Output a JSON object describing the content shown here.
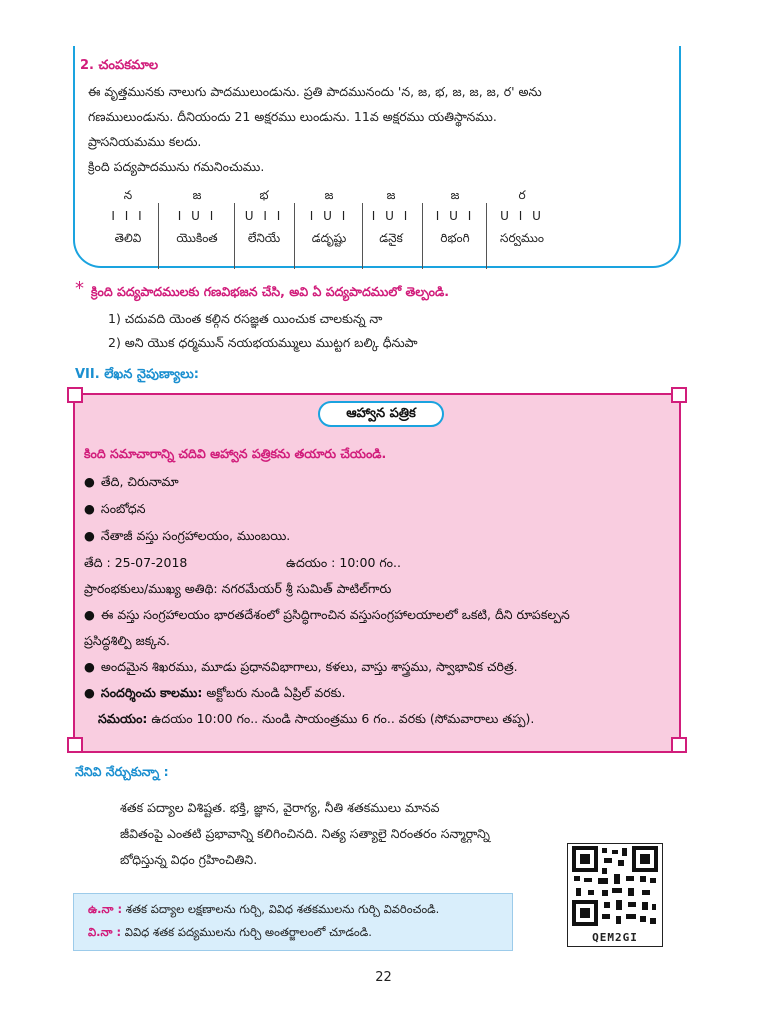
{
  "box1": {
    "title": "2. చంపకమాల",
    "lines": [
      "ఈ వృత్తమునకు నాలుగు పాదములుండును. ప్రతి పాదమునందు 'న, జ, భ, జ, జ, జ, ర' అను",
      "గణములుండును. దీనియందు 21 అక్షరము లుండును. 11వ అక్షరము యతిస్థానము.",
      "ప్రాసనియమము కలదు.",
      "క్రింది పద్యపాదమును గమనించుము."
    ],
    "ganas": [
      {
        "name": "న",
        "pattern": "I I I",
        "word": "తెలివి"
      },
      {
        "name": "జ",
        "pattern": "I U I",
        "word": "యొకింత"
      },
      {
        "name": "భ",
        "pattern": "U I I",
        "word": "లేనియే"
      },
      {
        "name": "జ",
        "pattern": "I U I",
        "word": "డదృష్టు"
      },
      {
        "name": "జ",
        "pattern": "I U I",
        "word": "డనైక"
      },
      {
        "name": "జ",
        "pattern": "I U I",
        "word": "రిభంగి"
      },
      {
        "name": "ర",
        "pattern": "U I U",
        "word": "సర్వముం"
      }
    ]
  },
  "exercise": {
    "star": "*",
    "instruction": "క్రింది పద్యపాదములకు గణవిభజన చేసి, అవి ఏ పద్యపాదములో తెల్పండి.",
    "items": [
      "1)  చదువది యెంత కల్గిన రసజ్ఞత యించుక చాలకున్న నా",
      "2)  అని యొక ధర్మమున్ నయభయమ్ములు ముట్టగ బల్కి ధీనుపా"
    ]
  },
  "section_vii": {
    "title": "VII. లేఖన నైపుణ్యాలు:"
  },
  "invitation": {
    "title": "ఆహ్వాన పత్రిక",
    "instruction": "కింది సమాచారాన్ని చదివి ఆహ్వాన పత్రికను తయారు చేయండి.",
    "bullets": [
      "తేది, చిరునామా",
      "సంబోధన",
      "నేతాజీ వస్తు సంగ్రహాలయం, ముంబయి."
    ],
    "date_line": "తేది : 25-07-2018",
    "time_line": "ఉదయం : 10:00 గం..",
    "chief_guest": "ప్రారంభకులు/ముఖ్య అతిథి: నగరమేయర్ శ్రీ సుమిత్ పాటిల్‌గారు",
    "feature1_a": "ఈ వస్తు సంగ్రహాలయం భారతదేశంలో ప్రసిద్ధిగాంచిన వస్తుసంగ్రహాలయాలలో ఒకటి, దీని రూపకల్పన",
    "feature1_b": "ప్రసిద్ధశిల్పి జక్కన.",
    "feature2": "అందమైన శిఖరము, మూడు ప్రధానవిభాగాలు, కళలు, వాస్తు శాస్త్రము, స్వాభావిక చరిత్ర.",
    "visit_label": "సందర్శించు కాలము:",
    "visit_value": " అక్టోబరు నుండి ఏప్రిల్ వరకు.",
    "timing_label": "సమయం:",
    "timing_value": " ఉదయం 10:00 గం.. నుండి సాయంత్రము 6 గం.. వరకు (సోమవారాలు తప్ప)."
  },
  "learned": {
    "title": "నేనివి నేర్చుకున్నా :",
    "lines": [
      "శతక పద్యాల విశిష్టత. భక్తి, జ్ఞాన, వైరాగ్య, నీతి శతకములు మానవ",
      "జీవితంపై ఎంతటి ప్రభావాన్ని కలిగించినది. నిత్య సత్యాలై నిరంతరం సన్మార్గాన్ని",
      "బోధిస్తున్న విధం గ్రహించితిని."
    ]
  },
  "reference": {
    "items": [
      {
        "key": "ఉ.నా :",
        "text": " శతక పద్యాల లక్షణాలను గుర్చి, వివిధ శతకములను గుర్చి వివరించండి."
      },
      {
        "key": "వి.నా :",
        "text": " వివిధ శతక పద్యములను గుర్చి అంతర్జాలంలో చూడండి."
      }
    ]
  },
  "qr": {
    "label": "QEM2GI"
  },
  "page_number": "22",
  "colors": {
    "magenta": "#d11d7b",
    "blue": "#1aa3df",
    "pink_bg": "#f9cde0",
    "ref_bg": "#d9eefb"
  }
}
